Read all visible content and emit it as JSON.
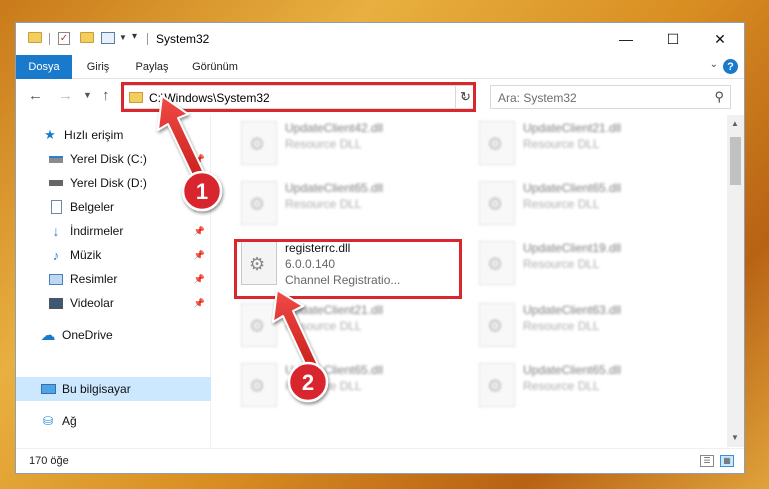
{
  "window": {
    "title": "System32",
    "minimize_glyph": "—",
    "maximize_glyph": "☐",
    "close_glyph": "✕"
  },
  "ribbon": {
    "tabs": [
      "Dosya",
      "Giriş",
      "Paylaş",
      "Görünüm"
    ],
    "help_glyph": "?",
    "expand_glyph": "⌄"
  },
  "address": {
    "path": "C:\\Windows\\System32",
    "search_placeholder": "Ara: System32"
  },
  "nav": {
    "quick_access": "Hızlı erişim",
    "items": [
      {
        "label": "Yerel Disk (C:)",
        "pinned": true
      },
      {
        "label": "Yerel Disk (D:)",
        "pinned": false
      },
      {
        "label": "Belgeler",
        "pinned": true
      },
      {
        "label": "İndirmeler",
        "pinned": true
      },
      {
        "label": "Müzik",
        "pinned": true
      },
      {
        "label": "Resimler",
        "pinned": true
      },
      {
        "label": "Videolar",
        "pinned": true
      }
    ],
    "onedrive": "OneDrive",
    "this_pc": "Bu bilgisayar",
    "network": "Ağ"
  },
  "files": [
    {
      "name": "UpdateClient42.dll",
      "sub": "Resource DLL"
    },
    {
      "name": "UpdateClient21.dll",
      "sub": "Resource DLL"
    },
    {
      "name": "UpdateClient65.dll",
      "sub": "Resource DLL"
    },
    {
      "name": "UpdateClient65.dll",
      "sub": "Resource DLL"
    },
    {
      "name": "registerrc.dll",
      "version": "6.0.0.140",
      "sub": "Channel Registratio..."
    },
    {
      "name": "UpdateClient19.dll",
      "sub": "Resource DLL"
    },
    {
      "name": "UpdateClient21.dll",
      "sub": "Resource DLL"
    },
    {
      "name": "UpdateClient63.dll",
      "sub": "Resource DLL"
    },
    {
      "name": "UpdateClient65.dll",
      "sub": "Resource DLL"
    },
    {
      "name": "UpdateClient65.dll",
      "sub": "Resource DLL"
    }
  ],
  "status": {
    "item_count": "170 öğe"
  },
  "annotations": {
    "step1": "1",
    "step2": "2"
  },
  "colors": {
    "accent": "#1979ca",
    "highlight_red": "#d9272e",
    "selection": "#cce8ff",
    "arrow_red": "#e0302f"
  }
}
